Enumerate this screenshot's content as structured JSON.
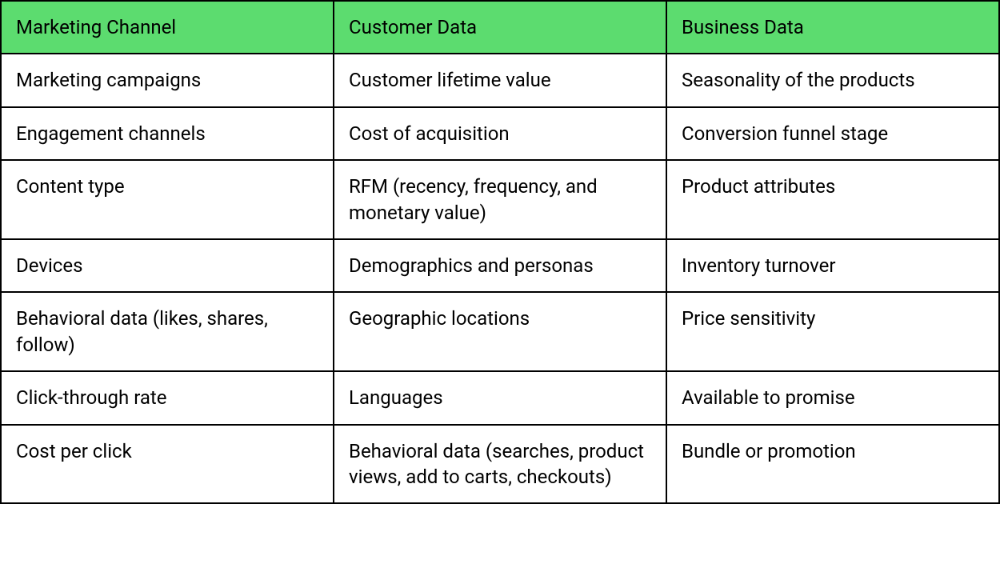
{
  "table": {
    "headers": [
      "Marketing Channel",
      "Customer Data",
      "Business Data"
    ],
    "rows": [
      [
        "Marketing campaigns",
        "Customer lifetime value",
        "Seasonality of the products"
      ],
      [
        "Engagement channels",
        "Cost of acquisition",
        "Conversion funnel stage"
      ],
      [
        "Content type",
        "RFM (recency, frequency, and monetary value)",
        "Product attributes"
      ],
      [
        "Devices",
        "Demographics and personas",
        "Inventory turnover"
      ],
      [
        "Behavioral data (likes, shares, follow)",
        "Geographic locations",
        "Price sensitivity"
      ],
      [
        "Click-through rate",
        "Languages",
        "Available to promise"
      ],
      [
        "Cost per click",
        "Behavioral data (searches, product views, add to carts, checkouts)",
        "Bundle or promotion"
      ]
    ]
  },
  "colors": {
    "header_bg": "#5cdc6f",
    "border": "#000000",
    "text": "#000000"
  }
}
